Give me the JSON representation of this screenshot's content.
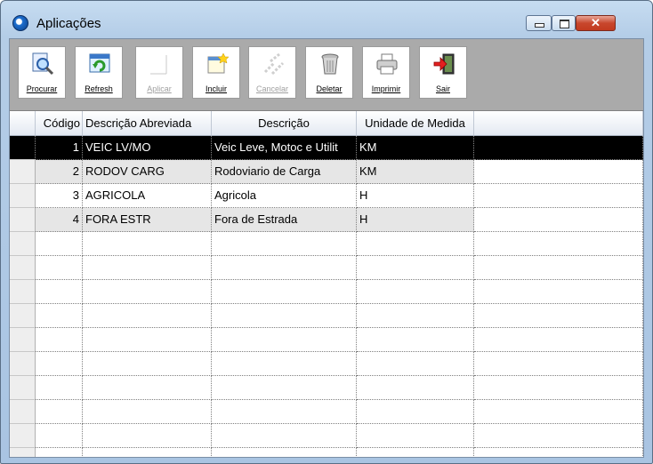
{
  "window": {
    "title": "Aplicações"
  },
  "toolbar": {
    "buttons": [
      {
        "label": "Procurar",
        "icon": "search-icon",
        "enabled": true
      },
      {
        "label": "Refresh",
        "icon": "refresh-icon",
        "enabled": true
      },
      {
        "label": "Aplicar",
        "icon": "apply-icon",
        "enabled": false
      },
      {
        "label": "Incluir",
        "icon": "new-document-icon",
        "enabled": true
      },
      {
        "label": "Cancelar",
        "icon": "cancel-icon",
        "enabled": false
      },
      {
        "label": "Deletar",
        "icon": "trash-icon",
        "enabled": true
      },
      {
        "label": "Imprimir",
        "icon": "printer-icon",
        "enabled": true
      },
      {
        "label": "Sair",
        "icon": "exit-icon",
        "enabled": true
      }
    ]
  },
  "table": {
    "columns": [
      "Código",
      "Descrição Abreviada",
      "Descrição",
      "Unidade de Medida"
    ],
    "rows": [
      {
        "codigo": "1",
        "abreviada": "VEIC LV/MO",
        "descricao": "Veic Leve, Motoc e Utilit",
        "unidade": "KM",
        "selected": true
      },
      {
        "codigo": "2",
        "abreviada": "RODOV CARG",
        "descricao": "Rodoviario de Carga",
        "unidade": "KM",
        "selected": false
      },
      {
        "codigo": "3",
        "abreviada": "AGRICOLA",
        "descricao": "Agricola",
        "unidade": "H",
        "selected": false
      },
      {
        "codigo": "4",
        "abreviada": "FORA ESTR",
        "descricao": "Fora de Estrada",
        "unidade": "H",
        "selected": false
      }
    ]
  },
  "colors": {
    "selected_row": "#000000",
    "alt_row": "#e6e6e6",
    "toolbar_bg": "#aaaaaa",
    "title_bar": "#b4cde7"
  }
}
